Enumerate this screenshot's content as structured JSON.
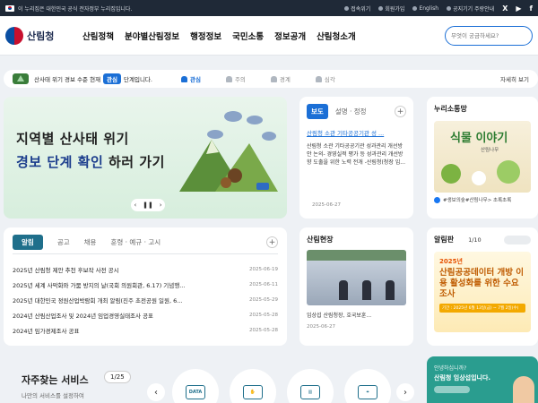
{
  "topbar": {
    "gov_notice": "이 누리집은 대한민국 공식 전자정부 누리집입니다.",
    "links": [
      "접속위기",
      "회원가입",
      "English",
      "공지기기 주랑안내"
    ]
  },
  "header": {
    "logo": "산림청",
    "nav": [
      "산림정책",
      "분야별산림정보",
      "행정정보",
      "국민소통",
      "정보공개",
      "산림청소개"
    ],
    "search_placeholder": "무엇이 궁금하세요?"
  },
  "alert": {
    "text_before": "산사태 위기 경보 수준 현재",
    "level": "관심",
    "text_after": "단계입니다.",
    "levels": [
      "관심",
      "주의",
      "경계",
      "심각"
    ],
    "more": "자세히 보기"
  },
  "banner": {
    "line1": "지역별 산사태 위기",
    "line2_a": "경보 단계 확인",
    "line2_b": "하러 가기",
    "ctrl": [
      "‹",
      "❚❚",
      "›"
    ]
  },
  "press": {
    "tabs": [
      "보도",
      "설명 · 정정"
    ],
    "headline": "산림청 소관 기타공공기관 성 ...",
    "body": "산림청 소관 기타공공기관 성과관리 개선방안 논의- 경영실적 평가 등 성과관리 개선방향 도출을 위한 노력 전개 -산림청(청장 임...",
    "date": "2025-06-27"
  },
  "community": {
    "title": "누리소통망",
    "img_title": "식물 이야기",
    "img_sub": "산림나무",
    "caption": "#생보의숲#산림나무> 초록초록"
  },
  "notice": {
    "tabs": [
      "알림",
      "공고",
      "채용",
      "훈령 · 예규 · 고시"
    ],
    "items": [
      {
        "title": "2025년 산림청 제안 추천 후보작 사전 공시",
        "date": "2025-06-19"
      },
      {
        "title": "2025년 세계 사막화와 가뭄 방지의 날(국회 의원회관, 6.17) 기념행...",
        "date": "2025-06-11"
      },
      {
        "title": "2025년 대한민국 정원산업박람회 개최 알림(진주 초전공원 일원, 6...",
        "date": "2025-05-29"
      },
      {
        "title": "2024년 산림산업조사 및 2024년 임업경영실태조사 공표",
        "date": "2025-05-28"
      },
      {
        "title": "2024년 임가경제조사 공표",
        "date": "2025-05-28"
      }
    ]
  },
  "forest": {
    "title": "산림현장",
    "caption": "임상섭 산림청장, 호국보훈...",
    "date": "2025-06-27"
  },
  "board": {
    "title": "알림판",
    "page": "1/10",
    "year": "2025년",
    "headline": "산림공공데이터 개방 이용 활성화를 위한 수요조사",
    "bar": "기간 : 2025년 6월 13일(금) ~ 7월 2일(수)"
  },
  "favorites": {
    "title": "자주찾는 서비스",
    "count": "1/25",
    "subtitle": "나만의 서비스를 설정하여",
    "svc1": "DATA"
  },
  "chat": {
    "line1": "안녕하십니까?",
    "line2": "산림청 임상섭입니다."
  }
}
